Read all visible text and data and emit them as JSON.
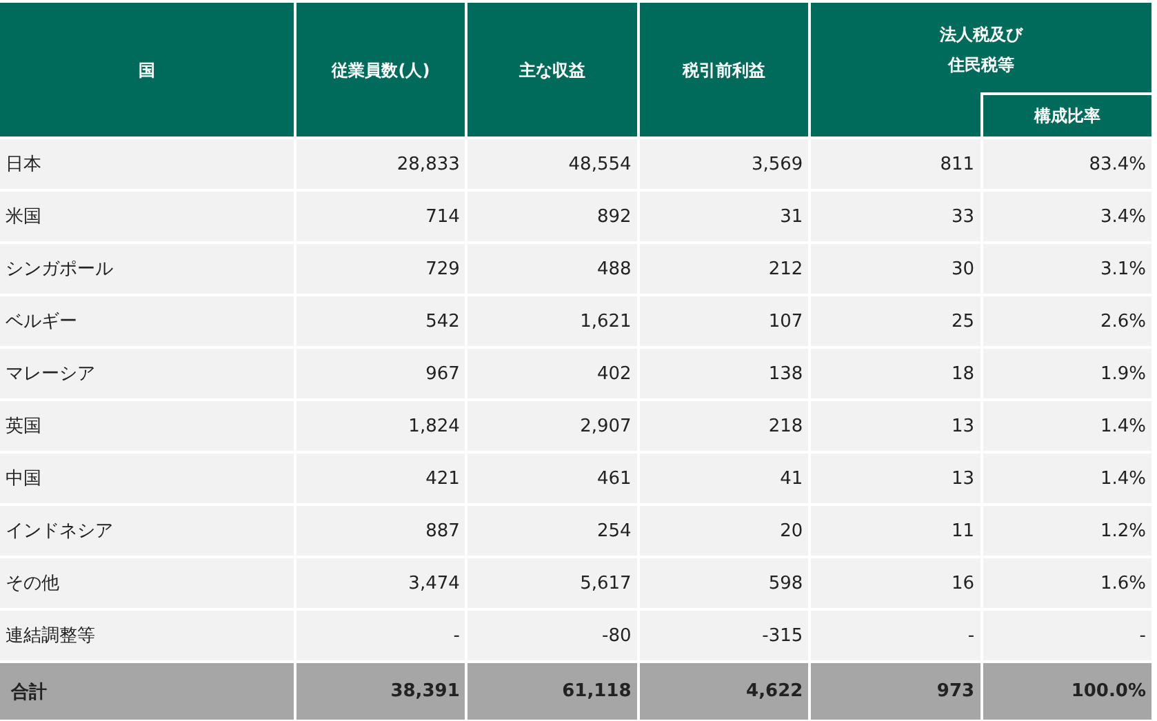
{
  "table": {
    "columns": [
      {
        "label": "国"
      },
      {
        "label": "従業員数(人)"
      },
      {
        "label": "主な収益"
      },
      {
        "label": "税引前利益"
      },
      {
        "label": "法人税及び住民税等"
      }
    ],
    "sub_column": "構成比率",
    "rows": [
      {
        "country": "日本",
        "employees": "28,833",
        "revenue": "48,554",
        "pretax": "3,569",
        "tax": "811",
        "ratio": "83.4%"
      },
      {
        "country": "米国",
        "employees": "714",
        "revenue": "892",
        "pretax": "31",
        "tax": "33",
        "ratio": "3.4%"
      },
      {
        "country": "シンガポール",
        "employees": "729",
        "revenue": "488",
        "pretax": "212",
        "tax": "30",
        "ratio": "3.1%"
      },
      {
        "country": "ベルギー",
        "employees": "542",
        "revenue": "1,621",
        "pretax": "107",
        "tax": "25",
        "ratio": "2.6%"
      },
      {
        "country": "マレーシア",
        "employees": "967",
        "revenue": "402",
        "pretax": "138",
        "tax": "18",
        "ratio": "1.9%"
      },
      {
        "country": "英国",
        "employees": "1,824",
        "revenue": "2,907",
        "pretax": "218",
        "tax": "13",
        "ratio": "1.4%"
      },
      {
        "country": "中国",
        "employees": "421",
        "revenue": "461",
        "pretax": "41",
        "tax": "13",
        "ratio": "1.4%"
      },
      {
        "country": "インドネシア",
        "employees": "887",
        "revenue": "254",
        "pretax": "20",
        "tax": "11",
        "ratio": "1.2%"
      },
      {
        "country": "その他",
        "employees": "3,474",
        "revenue": "5,617",
        "pretax": "598",
        "tax": "16",
        "ratio": "1.6%"
      },
      {
        "country": "連結調整等",
        "employees": "-",
        "revenue": "-80",
        "pretax": "-315",
        "tax": "-",
        "ratio": "-"
      }
    ],
    "total": {
      "country": "合計",
      "employees": "38,391",
      "revenue": "61,118",
      "pretax": "4,622",
      "tax": "973",
      "ratio": "100.0%"
    }
  }
}
